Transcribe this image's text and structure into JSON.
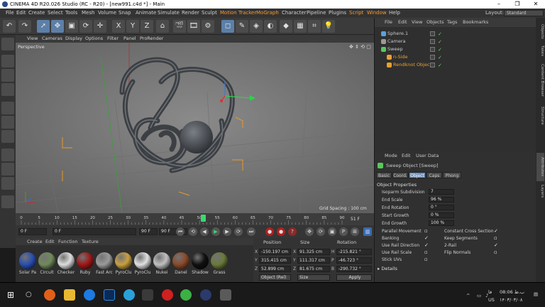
{
  "window": {
    "title": "CINEMA 4D R20.026 Studio (RC - R20) - [new991.c4d *] - Main",
    "controls": [
      "–",
      "❐",
      "✕"
    ]
  },
  "menubar": {
    "items": [
      "File",
      "Edit",
      "Create",
      "Select",
      "Tools",
      "Mesh",
      "Volume",
      "Snap",
      "Animate",
      "Simulate",
      "Render",
      "Sculpt",
      "Motion Tracker",
      "MoGraph",
      "Character",
      "Pipeline",
      "Plugins",
      "Script",
      "Window",
      "Help"
    ],
    "layout_label": "Layout:",
    "layout_value": "Standard"
  },
  "toolbar": {
    "axis_labels": [
      "X",
      "Y",
      "Z"
    ]
  },
  "viewport": {
    "menu": [
      "View",
      "Cameras",
      "Display",
      "Options",
      "Filter",
      "Panel",
      "ProRender"
    ],
    "label": "Perspective",
    "grid_spacing": "Grid Spacing : 100 cm"
  },
  "timeline": {
    "ticks": [
      "0",
      "5",
      "10",
      "15",
      "20",
      "25",
      "30",
      "35",
      "40",
      "45",
      "50",
      "55",
      "60",
      "65",
      "70",
      "75",
      "80",
      "85",
      "90"
    ],
    "current_frame_label": "51 F",
    "field_start": "0 F",
    "field_current": "0 F",
    "field_end": "90 F",
    "field_max": "90 F",
    "playhead_frame": 51
  },
  "materials": {
    "menu": [
      "Create",
      "Edit",
      "Function",
      "Texture"
    ],
    "items": [
      {
        "label": "Solar Pa",
        "color": "#2a4fb0"
      },
      {
        "label": "Circuit",
        "color": "#6f8a5a"
      },
      {
        "label": "Checker",
        "color": "#dddddd"
      },
      {
        "label": "Ruby",
        "color": "#a01818"
      },
      {
        "label": "Fast Arc",
        "color": "#9a9a9a"
      },
      {
        "label": "PyroClu",
        "color": "#c8a040"
      },
      {
        "label": "PyroClu",
        "color": "#e0e0e0"
      },
      {
        "label": "Nukei",
        "color": "#c0c0c0"
      },
      {
        "label": "Danel",
        "color": "#8a4a2a"
      },
      {
        "label": "Shadow",
        "color": "#101010"
      },
      {
        "label": "Grass",
        "color": "#6a7a3a"
      }
    ]
  },
  "coordinates": {
    "headers": [
      "Position",
      "Size",
      "Rotation"
    ],
    "rows": [
      {
        "axis_p": "X",
        "pos": "-150.197 cm",
        "axis_s": "X",
        "size": "91.325 cm",
        "axis_r": "H",
        "rot": "-215.821 °"
      },
      {
        "axis_p": "Y",
        "pos": "315.415 cm",
        "axis_s": "Y",
        "size": "111.317 cm",
        "axis_r": "P",
        "rot": "-46.723 °"
      },
      {
        "axis_p": "Z",
        "pos": "52.899 cm",
        "axis_s": "Z",
        "size": "81.675 cm",
        "axis_r": "B",
        "rot": "-290.732 °"
      }
    ],
    "mode": "Object (Rel)",
    "size_mode": "Size",
    "apply": "Apply"
  },
  "objects": {
    "tabs": [
      "File",
      "Edit",
      "View",
      "Objects",
      "Tags",
      "Bookmarks"
    ],
    "list": [
      {
        "name": "Sphere.1",
        "color": "#c8c8c8",
        "iconcolor": "#5aa0e0"
      },
      {
        "name": "Camera",
        "color": "#c8c8c8",
        "iconcolor": "#9a9a9a"
      },
      {
        "name": "Sweep",
        "color": "#c8c8c8",
        "iconcolor": "#5ac85a"
      },
      {
        "name": "n-Side",
        "color": "#e8a030",
        "iconcolor": "#e8a030"
      },
      {
        "name": "Rendknot Object",
        "color": "#e8a030",
        "iconcolor": "#e8a030"
      }
    ]
  },
  "attributes": {
    "menu": [
      "Mode",
      "Edit",
      "User Data"
    ],
    "object_title": "Sweep Object [Sweep]",
    "tabs": [
      "Basic",
      "Coord.",
      "Object",
      "Caps",
      "Phong"
    ],
    "section": "Object Properties",
    "props": [
      {
        "label": "Isoparm Subdivision",
        "value": "7"
      },
      {
        "label": "End Scale",
        "value": "96 %"
      },
      {
        "label": "End Rotation",
        "value": "0 °"
      },
      {
        "label": "Start Growth",
        "value": "0 %"
      },
      {
        "label": "End Growth",
        "value": "100 %"
      }
    ],
    "checks_left": [
      "Parallel Movement",
      "Banking",
      "Use Rail Direction",
      "Use Rail Scale",
      "Stick UVs"
    ],
    "checks_right": [
      "Constant Cross Section",
      "Keep Segments",
      "2-Rail",
      "Flip Normals"
    ],
    "details": "Details"
  },
  "right_strip": [
    "Objects",
    "Takes",
    "Content Browser",
    "Structure",
    "Attributes",
    "Layers"
  ],
  "taskbar": {
    "time": "08:06 ب.ظ",
    "date": "۱۴۰۳/۰۳/۰۸",
    "lang": "US",
    "lang2": "فا"
  }
}
